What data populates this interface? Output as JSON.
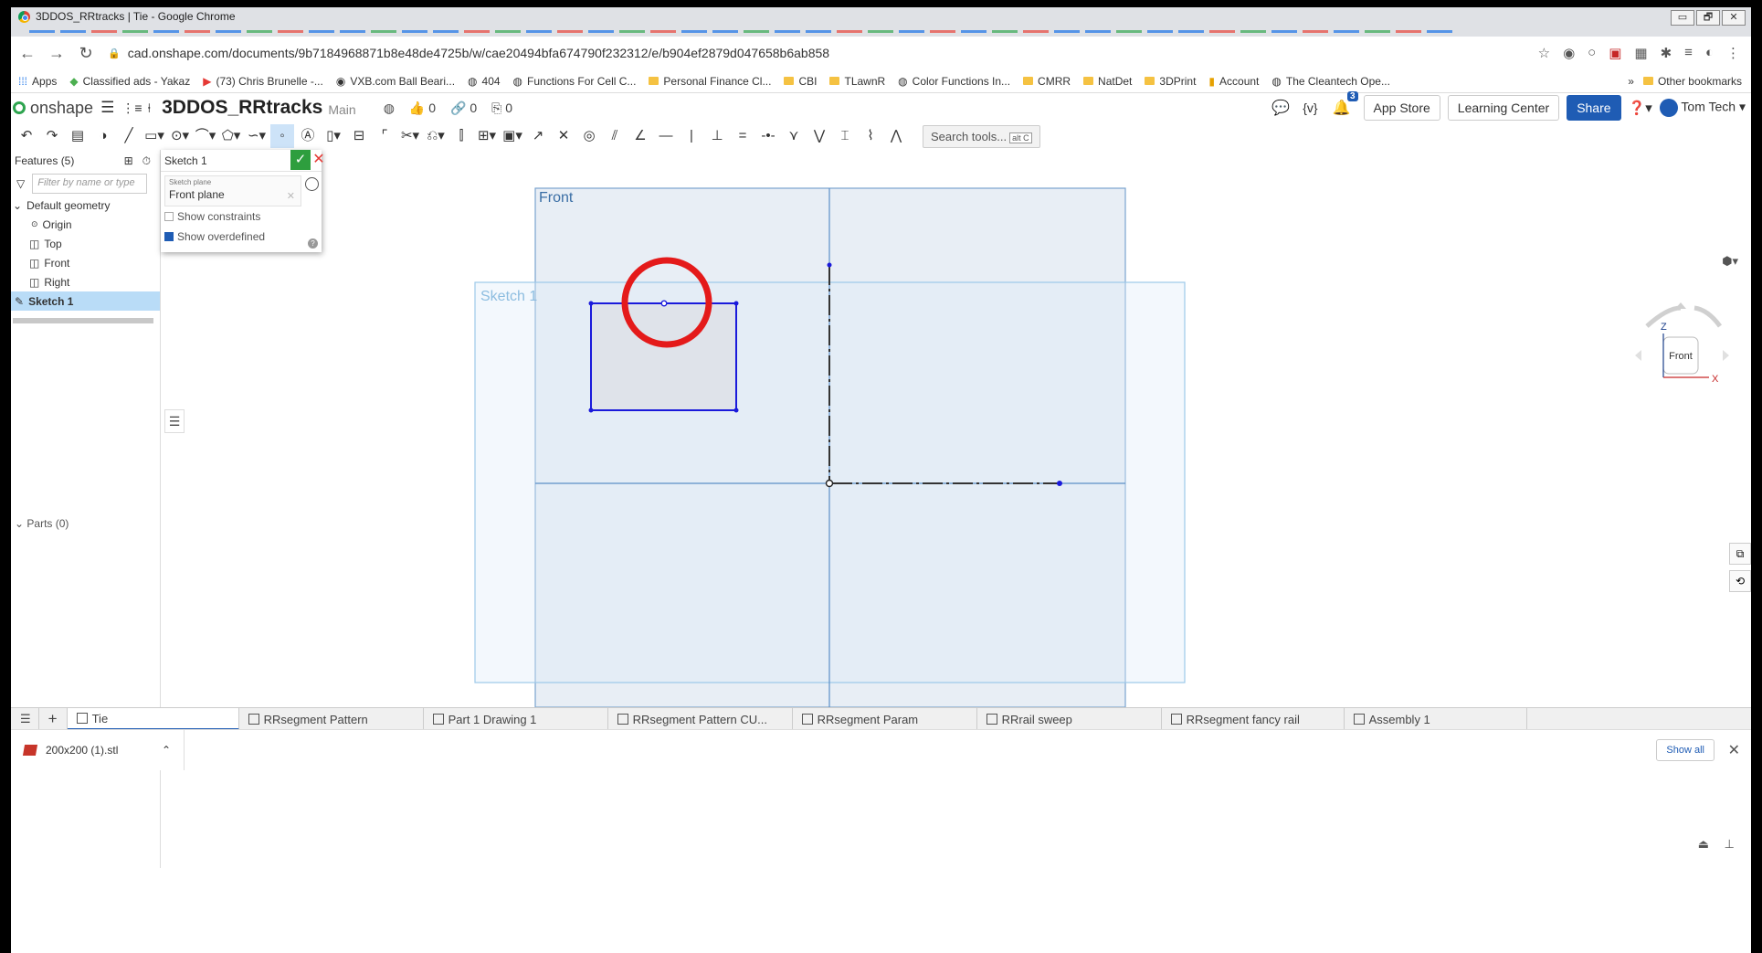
{
  "browser": {
    "window_title": "3DDOS_RRtracks | Tie - Google Chrome",
    "url": "cad.onshape.com/documents/9b7184968871b8e48de4725b/w/cae20494bfa674790f232312/e/b904ef2879d047658b6ab858",
    "window_controls": [
      "▭",
      "🗗",
      "✕"
    ]
  },
  "bookmarks": {
    "items": [
      {
        "label": "Apps"
      },
      {
        "label": "Classified ads - Yakaz"
      },
      {
        "label": "(73) Chris Brunelle -..."
      },
      {
        "label": "VXB.com Ball Beari..."
      },
      {
        "label": "404"
      },
      {
        "label": "Functions For Cell C..."
      },
      {
        "label": "Personal Finance Cl..."
      },
      {
        "label": "CBI"
      },
      {
        "label": "TLawnR"
      },
      {
        "label": "Color Functions In..."
      },
      {
        "label": "CMRR"
      },
      {
        "label": "NatDet"
      },
      {
        "label": "3DPrint"
      },
      {
        "label": "Account"
      },
      {
        "label": "The Cleantech Ope..."
      }
    ],
    "overflow": "»",
    "other": "Other bookmarks"
  },
  "header": {
    "app_name": "onshape",
    "document_name": "3DDOS_RRtracks",
    "branch": "Main",
    "likes": "0",
    "links": "0",
    "copies": "0",
    "notification_count": "3",
    "app_store": "App Store",
    "learning_center": "Learning Center",
    "share": "Share",
    "user": "Tom Tech"
  },
  "toolbar": {
    "search_placeholder": "Search tools...",
    "search_shortcut": "alt C"
  },
  "feature_tree": {
    "title": "Features (5)",
    "filter_placeholder": "Filter by name or type",
    "default_geometry": "Default geometry",
    "items": [
      {
        "label": "Origin"
      },
      {
        "label": "Top"
      },
      {
        "label": "Front"
      },
      {
        "label": "Right"
      }
    ],
    "selected_item": "Sketch 1",
    "parts": "Parts (0)"
  },
  "sketch_dialog": {
    "title": "Sketch 1",
    "plane_label": "Sketch plane",
    "plane_value": "Front plane",
    "show_constraints": "Show constraints",
    "show_constraints_checked": false,
    "show_overdefined": "Show overdefined",
    "show_overdefined_checked": true
  },
  "canvas": {
    "front_plane_label": "Front",
    "sketch_label": "Sketch 1",
    "highlight_color": "#e41a1a",
    "sketch_color": "#1a1adb",
    "plane_color": "#5b8fc7"
  },
  "view_cube": {
    "face": "Front",
    "axis_z": "Z",
    "axis_x": "X"
  },
  "bottom_tabs": [
    {
      "label": "Tie",
      "active": true
    },
    {
      "label": "RRsegment Pattern"
    },
    {
      "label": "Part 1 Drawing 1"
    },
    {
      "label": "RRsegment Pattern CU..."
    },
    {
      "label": "RRsegment Param"
    },
    {
      "label": "RRrail sweep"
    },
    {
      "label": "RRsegment fancy rail"
    },
    {
      "label": "Assembly 1"
    }
  ],
  "downloads": {
    "file": "200x200 (1).stl",
    "show_all": "Show all"
  }
}
